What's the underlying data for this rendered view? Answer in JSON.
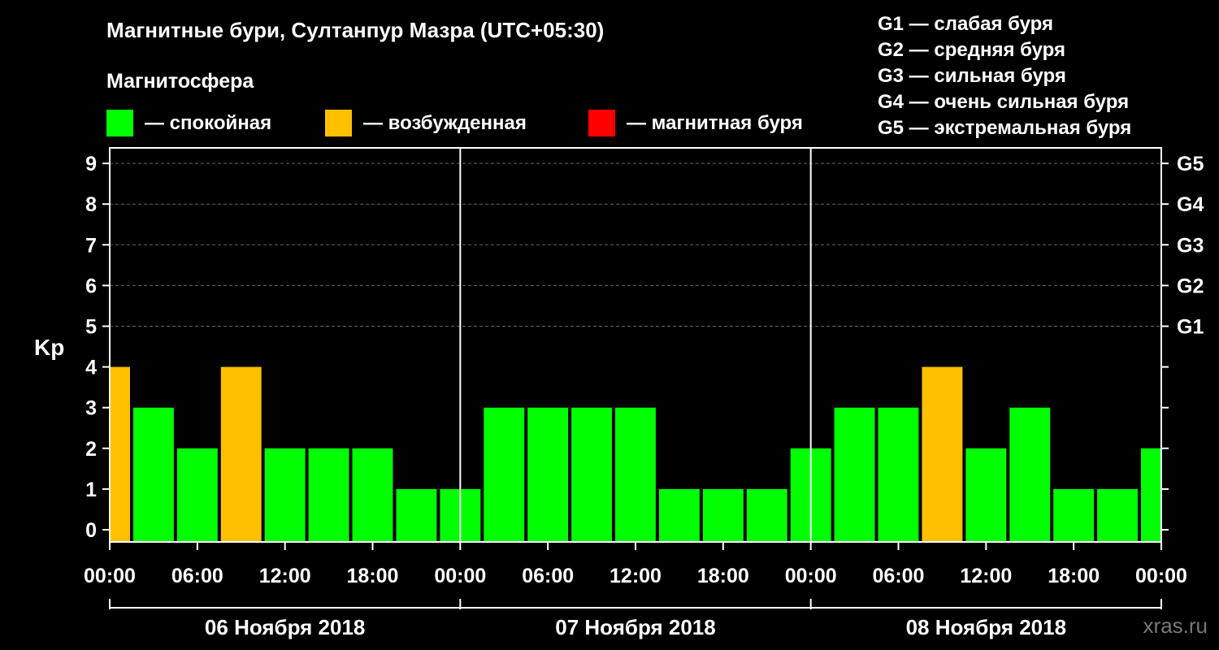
{
  "title": "Магнитные бури, Султанпур Мазра (UTC+05:30)",
  "subtitle": "Магнитосфера",
  "legend": [
    {
      "label": "— спокойная",
      "color": "#00ff00"
    },
    {
      "label": "— возбужденная",
      "color": "#ffc000"
    },
    {
      "label": "— магнитная буря",
      "color": "#ff0000"
    }
  ],
  "storm_scale": [
    "G1 — слабая буря",
    "G2 — средняя буря",
    "G3 — сильная буря",
    "G4 — очень сильная буря",
    "G5 — экстремальная буря"
  ],
  "watermark": "xras.ru",
  "chart_data": {
    "type": "bar",
    "ylabel": "Kp",
    "ylim": [
      0,
      9
    ],
    "yticks": [
      0,
      1,
      2,
      3,
      4,
      5,
      6,
      7,
      8,
      9
    ],
    "right_axis_labels": [
      {
        "kp": 5,
        "label": "G1"
      },
      {
        "kp": 6,
        "label": "G2"
      },
      {
        "kp": 7,
        "label": "G3"
      },
      {
        "kp": 8,
        "label": "G4"
      },
      {
        "kp": 9,
        "label": "G5"
      }
    ],
    "grid": "horizontal dashed",
    "xticks": [
      "00:00",
      "06:00",
      "12:00",
      "18:00",
      "00:00",
      "06:00",
      "12:00",
      "18:00",
      "00:00",
      "06:00",
      "12:00",
      "18:00",
      "00:00"
    ],
    "days": [
      "06 Ноября 2018",
      "07 Ноября 2018",
      "08 Ноября 2018"
    ],
    "bar_interval_hours": 3,
    "x_start_hour": 0,
    "x_end_hour": 72,
    "series": [
      {
        "values": [
          {
            "start_hour": 0,
            "end_hour": 1.5,
            "kp": 4,
            "status": "возбужденная"
          },
          {
            "start_hour": 1.5,
            "end_hour": 4.5,
            "kp": 3,
            "status": "спокойная"
          },
          {
            "start_hour": 4.5,
            "end_hour": 7.5,
            "kp": 2,
            "status": "спокойная"
          },
          {
            "start_hour": 7.5,
            "end_hour": 10.5,
            "kp": 4,
            "status": "возбужденная"
          },
          {
            "start_hour": 10.5,
            "end_hour": 13.5,
            "kp": 2,
            "status": "спокойная"
          },
          {
            "start_hour": 13.5,
            "end_hour": 16.5,
            "kp": 2,
            "status": "спокойная"
          },
          {
            "start_hour": 16.5,
            "end_hour": 19.5,
            "kp": 2,
            "status": "спокойная"
          },
          {
            "start_hour": 19.5,
            "end_hour": 22.5,
            "kp": 1,
            "status": "спокойная"
          },
          {
            "start_hour": 22.5,
            "end_hour": 25.5,
            "kp": 1,
            "status": "спокойная"
          },
          {
            "start_hour": 25.5,
            "end_hour": 28.5,
            "kp": 3,
            "status": "спокойная"
          },
          {
            "start_hour": 28.5,
            "end_hour": 31.5,
            "kp": 3,
            "status": "спокойная"
          },
          {
            "start_hour": 31.5,
            "end_hour": 34.5,
            "kp": 3,
            "status": "спокойная"
          },
          {
            "start_hour": 34.5,
            "end_hour": 37.5,
            "kp": 3,
            "status": "спокойная"
          },
          {
            "start_hour": 37.5,
            "end_hour": 40.5,
            "kp": 1,
            "status": "спокойная"
          },
          {
            "start_hour": 40.5,
            "end_hour": 43.5,
            "kp": 1,
            "status": "спокойная"
          },
          {
            "start_hour": 43.5,
            "end_hour": 46.5,
            "kp": 1,
            "status": "спокойная"
          },
          {
            "start_hour": 46.5,
            "end_hour": 49.5,
            "kp": 2,
            "status": "спокойная"
          },
          {
            "start_hour": 49.5,
            "end_hour": 52.5,
            "kp": 3,
            "status": "спокойная"
          },
          {
            "start_hour": 52.5,
            "end_hour": 55.5,
            "kp": 3,
            "status": "спокойная"
          },
          {
            "start_hour": 55.5,
            "end_hour": 58.5,
            "kp": 4,
            "status": "возбужденная"
          },
          {
            "start_hour": 58.5,
            "end_hour": 61.5,
            "kp": 2,
            "status": "спокойная"
          },
          {
            "start_hour": 61.5,
            "end_hour": 64.5,
            "kp": 3,
            "status": "спокойная"
          },
          {
            "start_hour": 64.5,
            "end_hour": 67.5,
            "kp": 1,
            "status": "спокойная"
          },
          {
            "start_hour": 67.5,
            "end_hour": 70.5,
            "kp": 1,
            "status": "спокойная"
          },
          {
            "start_hour": 70.5,
            "end_hour": 72,
            "kp": 2,
            "status": "спокойная"
          }
        ]
      }
    ]
  }
}
